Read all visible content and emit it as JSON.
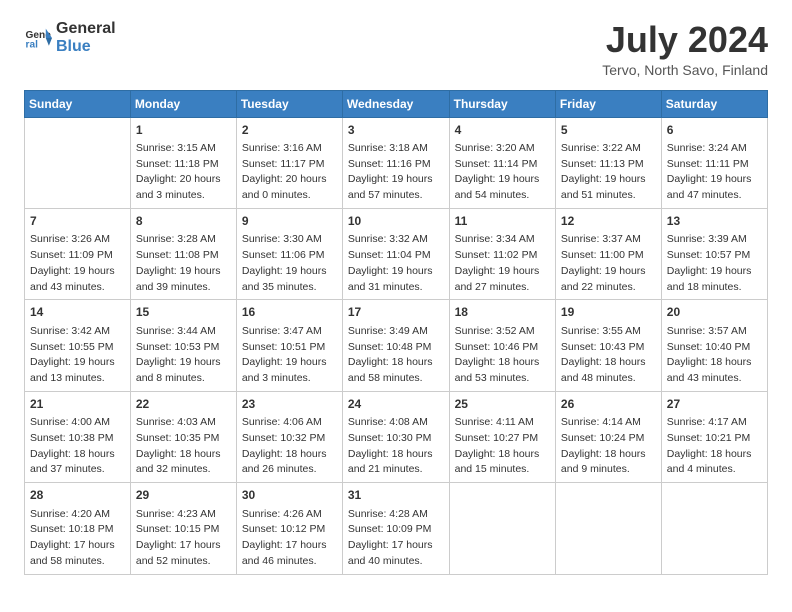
{
  "logo": {
    "general": "General",
    "blue": "Blue"
  },
  "title": "July 2024",
  "location": "Tervo, North Savo, Finland",
  "weekdays": [
    "Sunday",
    "Monday",
    "Tuesday",
    "Wednesday",
    "Thursday",
    "Friday",
    "Saturday"
  ],
  "weeks": [
    [
      {
        "day": "",
        "info": ""
      },
      {
        "day": "1",
        "info": "Sunrise: 3:15 AM\nSunset: 11:18 PM\nDaylight: 20 hours\nand 3 minutes."
      },
      {
        "day": "2",
        "info": "Sunrise: 3:16 AM\nSunset: 11:17 PM\nDaylight: 20 hours\nand 0 minutes."
      },
      {
        "day": "3",
        "info": "Sunrise: 3:18 AM\nSunset: 11:16 PM\nDaylight: 19 hours\nand 57 minutes."
      },
      {
        "day": "4",
        "info": "Sunrise: 3:20 AM\nSunset: 11:14 PM\nDaylight: 19 hours\nand 54 minutes."
      },
      {
        "day": "5",
        "info": "Sunrise: 3:22 AM\nSunset: 11:13 PM\nDaylight: 19 hours\nand 51 minutes."
      },
      {
        "day": "6",
        "info": "Sunrise: 3:24 AM\nSunset: 11:11 PM\nDaylight: 19 hours\nand 47 minutes."
      }
    ],
    [
      {
        "day": "7",
        "info": "Sunrise: 3:26 AM\nSunset: 11:09 PM\nDaylight: 19 hours\nand 43 minutes."
      },
      {
        "day": "8",
        "info": "Sunrise: 3:28 AM\nSunset: 11:08 PM\nDaylight: 19 hours\nand 39 minutes."
      },
      {
        "day": "9",
        "info": "Sunrise: 3:30 AM\nSunset: 11:06 PM\nDaylight: 19 hours\nand 35 minutes."
      },
      {
        "day": "10",
        "info": "Sunrise: 3:32 AM\nSunset: 11:04 PM\nDaylight: 19 hours\nand 31 minutes."
      },
      {
        "day": "11",
        "info": "Sunrise: 3:34 AM\nSunset: 11:02 PM\nDaylight: 19 hours\nand 27 minutes."
      },
      {
        "day": "12",
        "info": "Sunrise: 3:37 AM\nSunset: 11:00 PM\nDaylight: 19 hours\nand 22 minutes."
      },
      {
        "day": "13",
        "info": "Sunrise: 3:39 AM\nSunset: 10:57 PM\nDaylight: 19 hours\nand 18 minutes."
      }
    ],
    [
      {
        "day": "14",
        "info": "Sunrise: 3:42 AM\nSunset: 10:55 PM\nDaylight: 19 hours\nand 13 minutes."
      },
      {
        "day": "15",
        "info": "Sunrise: 3:44 AM\nSunset: 10:53 PM\nDaylight: 19 hours\nand 8 minutes."
      },
      {
        "day": "16",
        "info": "Sunrise: 3:47 AM\nSunset: 10:51 PM\nDaylight: 19 hours\nand 3 minutes."
      },
      {
        "day": "17",
        "info": "Sunrise: 3:49 AM\nSunset: 10:48 PM\nDaylight: 18 hours\nand 58 minutes."
      },
      {
        "day": "18",
        "info": "Sunrise: 3:52 AM\nSunset: 10:46 PM\nDaylight: 18 hours\nand 53 minutes."
      },
      {
        "day": "19",
        "info": "Sunrise: 3:55 AM\nSunset: 10:43 PM\nDaylight: 18 hours\nand 48 minutes."
      },
      {
        "day": "20",
        "info": "Sunrise: 3:57 AM\nSunset: 10:40 PM\nDaylight: 18 hours\nand 43 minutes."
      }
    ],
    [
      {
        "day": "21",
        "info": "Sunrise: 4:00 AM\nSunset: 10:38 PM\nDaylight: 18 hours\nand 37 minutes."
      },
      {
        "day": "22",
        "info": "Sunrise: 4:03 AM\nSunset: 10:35 PM\nDaylight: 18 hours\nand 32 minutes."
      },
      {
        "day": "23",
        "info": "Sunrise: 4:06 AM\nSunset: 10:32 PM\nDaylight: 18 hours\nand 26 minutes."
      },
      {
        "day": "24",
        "info": "Sunrise: 4:08 AM\nSunset: 10:30 PM\nDaylight: 18 hours\nand 21 minutes."
      },
      {
        "day": "25",
        "info": "Sunrise: 4:11 AM\nSunset: 10:27 PM\nDaylight: 18 hours\nand 15 minutes."
      },
      {
        "day": "26",
        "info": "Sunrise: 4:14 AM\nSunset: 10:24 PM\nDaylight: 18 hours\nand 9 minutes."
      },
      {
        "day": "27",
        "info": "Sunrise: 4:17 AM\nSunset: 10:21 PM\nDaylight: 18 hours\nand 4 minutes."
      }
    ],
    [
      {
        "day": "28",
        "info": "Sunrise: 4:20 AM\nSunset: 10:18 PM\nDaylight: 17 hours\nand 58 minutes."
      },
      {
        "day": "29",
        "info": "Sunrise: 4:23 AM\nSunset: 10:15 PM\nDaylight: 17 hours\nand 52 minutes."
      },
      {
        "day": "30",
        "info": "Sunrise: 4:26 AM\nSunset: 10:12 PM\nDaylight: 17 hours\nand 46 minutes."
      },
      {
        "day": "31",
        "info": "Sunrise: 4:28 AM\nSunset: 10:09 PM\nDaylight: 17 hours\nand 40 minutes."
      },
      {
        "day": "",
        "info": ""
      },
      {
        "day": "",
        "info": ""
      },
      {
        "day": "",
        "info": ""
      }
    ]
  ]
}
